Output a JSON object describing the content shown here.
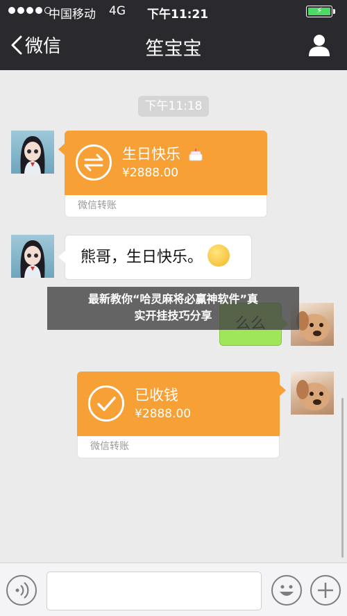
{
  "status_bar": {
    "carrier": "中国移动",
    "network": "4G",
    "time": "下午11:21"
  },
  "nav": {
    "back_label": "微信",
    "title": "笙宝宝"
  },
  "chat": {
    "timestamp": "下午11:18",
    "messages": [
      {
        "kind": "transfer",
        "direction": "incoming",
        "title": "生日快乐",
        "amount": "¥2888.00",
        "footer": "微信转账",
        "icon": "exchange-icon"
      },
      {
        "kind": "text",
        "direction": "incoming",
        "text": "熊哥，生日快乐。"
      },
      {
        "kind": "text",
        "direction": "outgoing",
        "text": "么么"
      },
      {
        "kind": "transfer",
        "direction": "outgoing",
        "title": "已收钱",
        "amount": "¥2888.00",
        "footer": "微信转账",
        "icon": "check-icon"
      }
    ]
  },
  "overlay": {
    "line1": "最新教你“哈灵麻将必赢神软件”真",
    "line2": "实开挂技巧分享"
  },
  "input_bar": {
    "placeholder": ""
  },
  "colors": {
    "header_bg": "#2a2a2e",
    "chat_bg": "#ebebeb",
    "transfer_orange": "#f7a036",
    "sent_green": "#9fe658",
    "battery_green": "#4cd964"
  }
}
